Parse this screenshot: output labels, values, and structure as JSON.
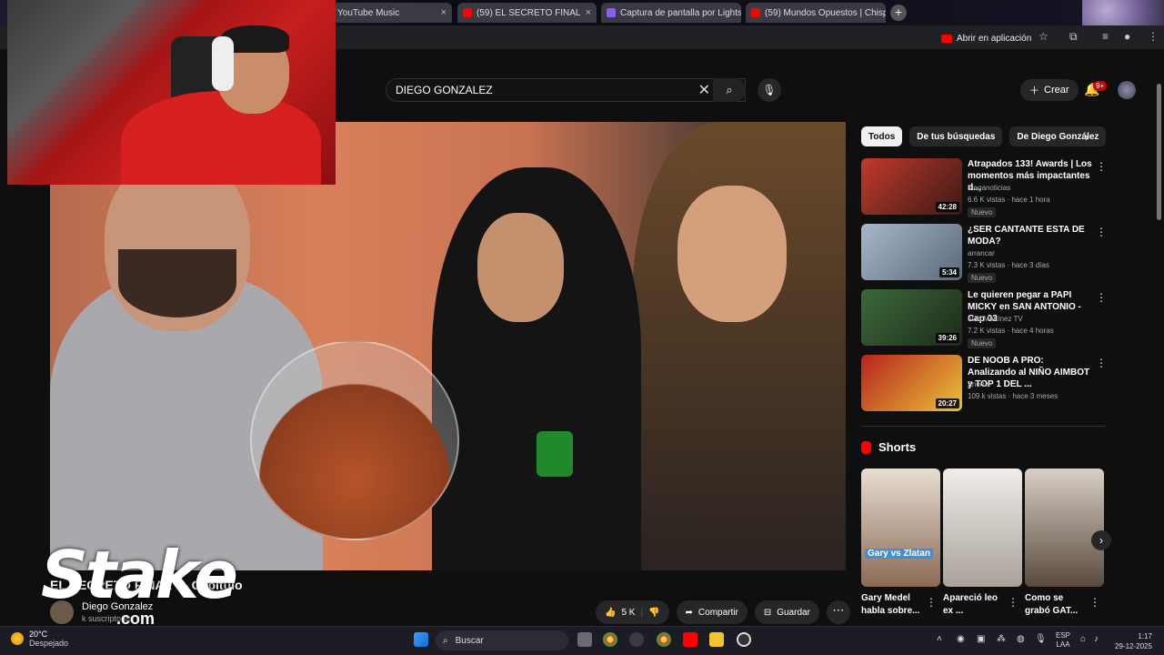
{
  "browser": {
    "tabs": [
      {
        "label": "YouTube Music",
        "favicon_color": "#ff0000"
      },
      {
        "label": "(59) EL SECRETO FINAL",
        "favicon_color": "#ff0000"
      },
      {
        "label": "Captura de pantalla por Lightshot",
        "favicon_color": "#8a5cf6"
      },
      {
        "label": "(59) Mundos Opuestos | Chisp...",
        "favicon_color": "#ff0000"
      }
    ],
    "open_in_app": "Abrir en aplicación"
  },
  "header": {
    "search_value": "DIEGO GONZALEZ",
    "create_label": "Crear",
    "notifications_badge": "9+"
  },
  "video": {
    "title": "EL SECRETO FINAL — Capítulo",
    "channel": "Diego Gonzalez",
    "subscribers": "k suscriptores",
    "likes": "5 K",
    "share_label": "Compartir",
    "save_label": "Guardar",
    "overlay_logo": "Stake",
    "overlay_logo_suffix": ".com"
  },
  "sidebar": {
    "chips": [
      "Todos",
      "De tus búsquedas",
      "De Diego González"
    ],
    "recommendations": [
      {
        "title": "Atrapados 133! Awards | Los momentos más impactantes d...",
        "channel": "Meganoticias",
        "meta": "6.6 K vistas · hace 1 hora",
        "badge": "Nuevo",
        "duration": "42:28",
        "thumb": "#c23a2b"
      },
      {
        "title": "¿SER CANTANTE ESTA DE MODA?",
        "channel": "arrancar",
        "meta": "7.3 K vistas · hace 3 días",
        "badge": "Nuevo",
        "duration": "5:34",
        "thumb": "#a7b6c9"
      },
      {
        "title": "Le quieren pegar a PAPI MICKY en SAN ANTONIO - Cap 03",
        "channel": "Iván Martínez TV",
        "meta": "7.2 K vistas · hace 4 horas",
        "badge": "Nuevo",
        "duration": "39:26",
        "thumb": "#3b6a3a"
      },
      {
        "title": "DE NOOB A PRO: Analizando al NIÑO AIMBOT y TOP 1 DEL ...",
        "channel": "Znorux",
        "meta": "109 k vistas · hace 3 meses",
        "badge": "",
        "duration": "20:27",
        "thumb": "#b8231e"
      }
    ],
    "shorts_title": "Shorts",
    "shorts": [
      {
        "title": "Gary Medel habla sobre...",
        "caption": "Gary vs Zlatan",
        "color": "#8a6a55"
      },
      {
        "title": "Apareció leo ex ...",
        "caption": "",
        "color": "#d9d4cf"
      },
      {
        "title": "Como se grabó GAT...",
        "caption": "",
        "color": "#a58d7a"
      }
    ]
  },
  "taskbar": {
    "temp": "20°C",
    "weather": "Despejado",
    "search_label": "Buscar",
    "lang_top": "ESP",
    "lang_bottom": "LAA",
    "time": "1:17",
    "date": "29-12-2025"
  },
  "icons": [
    "youtube-icon",
    "search-icon",
    "close-icon",
    "mic-icon",
    "plus-icon",
    "bell-icon",
    "chevron-right-icon",
    "like-icon",
    "dislike-icon",
    "share-icon",
    "save-icon",
    "more-icon",
    "kebab-icon",
    "windows-icon",
    "shorts-icon"
  ]
}
